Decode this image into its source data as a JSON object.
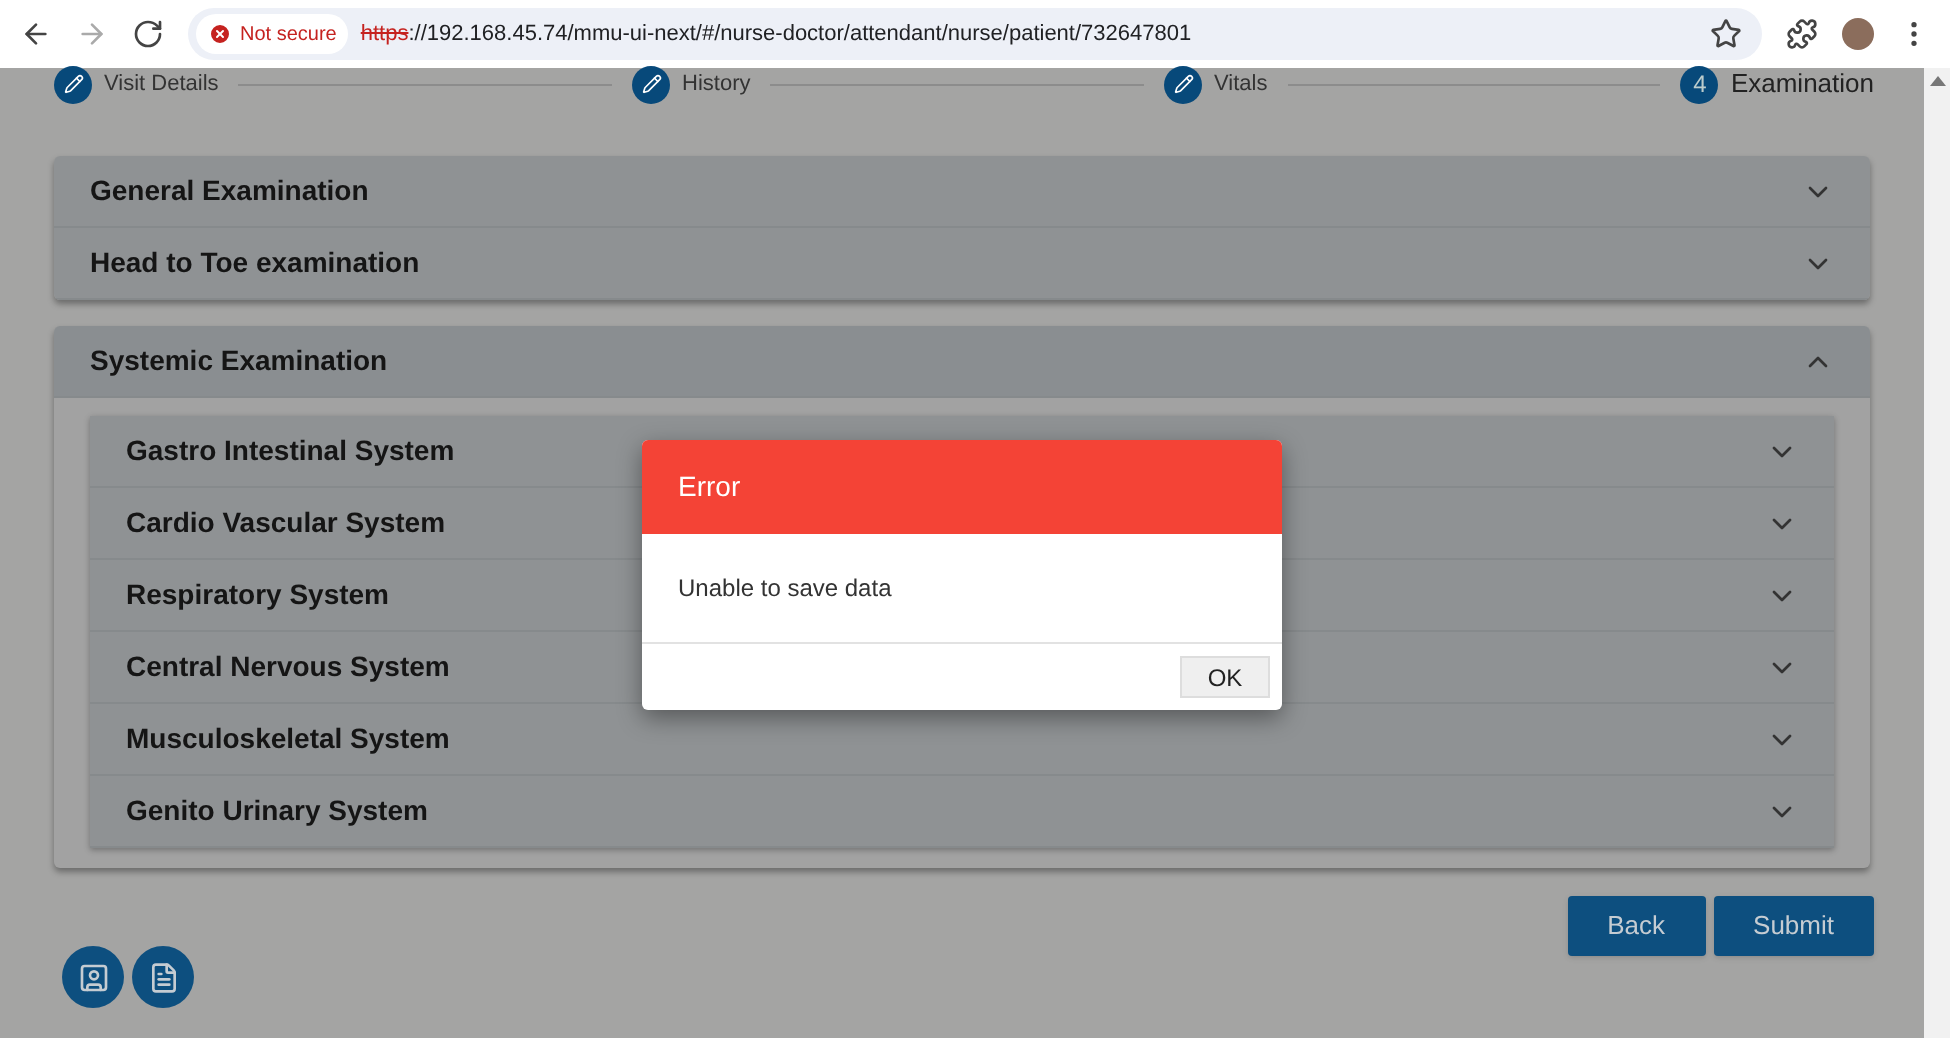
{
  "browser": {
    "security": "Not secure",
    "url_scheme": "https",
    "url_rest": "://192.168.45.74/mmu-ui-next/#/nurse-doctor/attendant/nurse/patient/732647801"
  },
  "steps": [
    {
      "label": "Visit Details",
      "kind": "done"
    },
    {
      "label": "History",
      "kind": "done"
    },
    {
      "label": "Vitals",
      "kind": "done"
    },
    {
      "label": "Examination",
      "kind": "number",
      "number": "4"
    }
  ],
  "sections": [
    {
      "title": "General Examination",
      "expanded": false
    },
    {
      "title": "Head to Toe examination",
      "expanded": false
    }
  ],
  "systemic": {
    "title": "Systemic Examination",
    "expanded": true,
    "items": [
      {
        "title": "Gastro Intestinal System",
        "expanded": false
      },
      {
        "title": "Cardio Vascular System",
        "expanded": false
      },
      {
        "title": "Respiratory System",
        "expanded": false
      },
      {
        "title": "Central Nervous System",
        "expanded": false
      },
      {
        "title": "Musculoskeletal System",
        "expanded": false
      },
      {
        "title": "Genito Urinary System",
        "expanded": false
      }
    ]
  },
  "buttons": [
    "Back",
    "Submit"
  ],
  "dialog": {
    "title": "Error",
    "message": "Unable to save data",
    "button": "OK"
  }
}
